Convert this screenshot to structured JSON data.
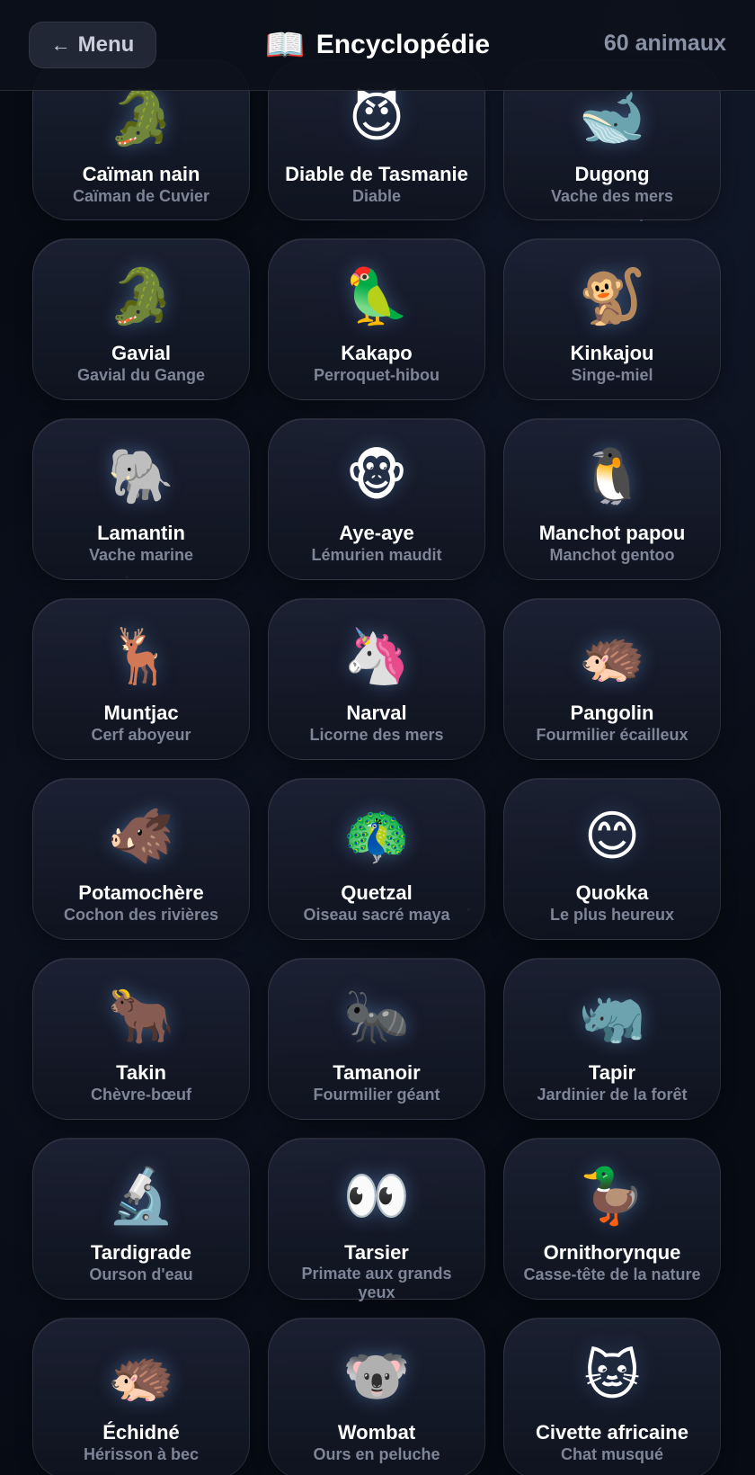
{
  "header": {
    "menu_label": "Menu",
    "menu_arrow": "←",
    "title_icon": "📖",
    "title": "Encyclopédie",
    "count": "60 animaux"
  },
  "colors": {
    "background": "#070b14",
    "card_name": "#ffffff",
    "card_subtitle": "#7d8597",
    "count_text": "#8a93a6"
  },
  "animals": [
    {
      "emoji": "🐊",
      "icon": "crocodile-icon",
      "name": "Caïman nain",
      "subtitle": "Caïman de Cuvier"
    },
    {
      "emoji": "😈",
      "icon": "devil-icon",
      "name": "Diable de Tasmanie",
      "subtitle": "Diable"
    },
    {
      "emoji": "🐋",
      "icon": "whale-icon",
      "name": "Dugong",
      "subtitle": "Vache des mers"
    },
    {
      "emoji": "🐊",
      "icon": "crocodile-icon",
      "name": "Gavial",
      "subtitle": "Gavial du Gange"
    },
    {
      "emoji": "🦜",
      "icon": "parrot-icon",
      "name": "Kakapo",
      "subtitle": "Perroquet-hibou"
    },
    {
      "emoji": "🐒",
      "icon": "monkey-icon",
      "name": "Kinkajou",
      "subtitle": "Singe-miel"
    },
    {
      "emoji": "🐘",
      "icon": "elephant-icon",
      "name": "Lamantin",
      "subtitle": "Vache marine"
    },
    {
      "emoji": "🐵",
      "icon": "monkey-face-icon",
      "name": "Aye-aye",
      "subtitle": "Lémurien maudit"
    },
    {
      "emoji": "🐧",
      "icon": "penguin-icon",
      "name": "Manchot papou",
      "subtitle": "Manchot gentoo"
    },
    {
      "emoji": "🦌",
      "icon": "deer-icon",
      "name": "Muntjac",
      "subtitle": "Cerf aboyeur"
    },
    {
      "emoji": "🦄",
      "icon": "unicorn-icon",
      "name": "Narval",
      "subtitle": "Licorne des mers"
    },
    {
      "emoji": "🦔",
      "icon": "hedgehog-icon",
      "name": "Pangolin",
      "subtitle": "Fourmilier écailleux"
    },
    {
      "emoji": "🐗",
      "icon": "boar-icon",
      "name": "Potamochère",
      "subtitle": "Cochon des rivières"
    },
    {
      "emoji": "🦚",
      "icon": "peacock-icon",
      "name": "Quetzal",
      "subtitle": "Oiseau sacré maya"
    },
    {
      "emoji": "😊",
      "icon": "smiling-face-icon",
      "name": "Quokka",
      "subtitle": "Le plus heureux"
    },
    {
      "emoji": "🐂",
      "icon": "ox-icon",
      "name": "Takin",
      "subtitle": "Chèvre-bœuf"
    },
    {
      "emoji": "🐜",
      "icon": "ant-icon",
      "name": "Tamanoir",
      "subtitle": "Fourmilier géant"
    },
    {
      "emoji": "🦏",
      "icon": "rhinoceros-icon",
      "name": "Tapir",
      "subtitle": "Jardinier de la forêt"
    },
    {
      "emoji": "🔬",
      "icon": "microscope-icon",
      "name": "Tardigrade",
      "subtitle": "Ourson d'eau"
    },
    {
      "emoji": "👀",
      "icon": "eyes-icon",
      "name": "Tarsier",
      "subtitle": "Primate aux grands yeux"
    },
    {
      "emoji": "🦆",
      "icon": "duck-icon",
      "name": "Ornithorynque",
      "subtitle": "Casse-tête de la nature"
    },
    {
      "emoji": "🦔",
      "icon": "hedgehog-icon",
      "name": "Échidné",
      "subtitle": "Hérisson à bec"
    },
    {
      "emoji": "🐨",
      "icon": "koala-icon",
      "name": "Wombat",
      "subtitle": "Ours en peluche"
    },
    {
      "emoji": "🐱",
      "icon": "cat-face-icon",
      "name": "Civette africaine",
      "subtitle": "Chat musqué"
    }
  ]
}
